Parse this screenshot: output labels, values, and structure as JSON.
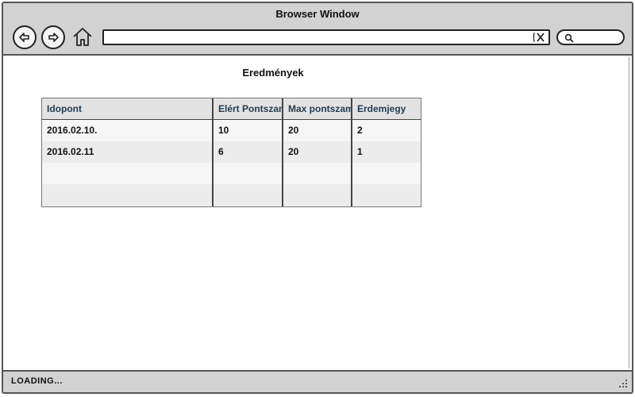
{
  "window": {
    "title": "Browser Window",
    "address_value": "",
    "status_text": "LOADING..."
  },
  "page": {
    "title": "Eredmények"
  },
  "table": {
    "headers": [
      "Idopont",
      "Elért Pontszam",
      "Max pontszam",
      "Erdemjegy"
    ],
    "rows": [
      [
        "2016.02.10.",
        "10",
        "20",
        "2"
      ],
      [
        "2016.02.11",
        "6",
        "20",
        "1"
      ],
      [
        "",
        "",
        "",
        ""
      ],
      [
        "",
        "",
        "",
        ""
      ]
    ],
    "row_colors": [
      "#f6f6f6",
      "#ececec",
      "#f6f6f6",
      "#ececec"
    ]
  }
}
